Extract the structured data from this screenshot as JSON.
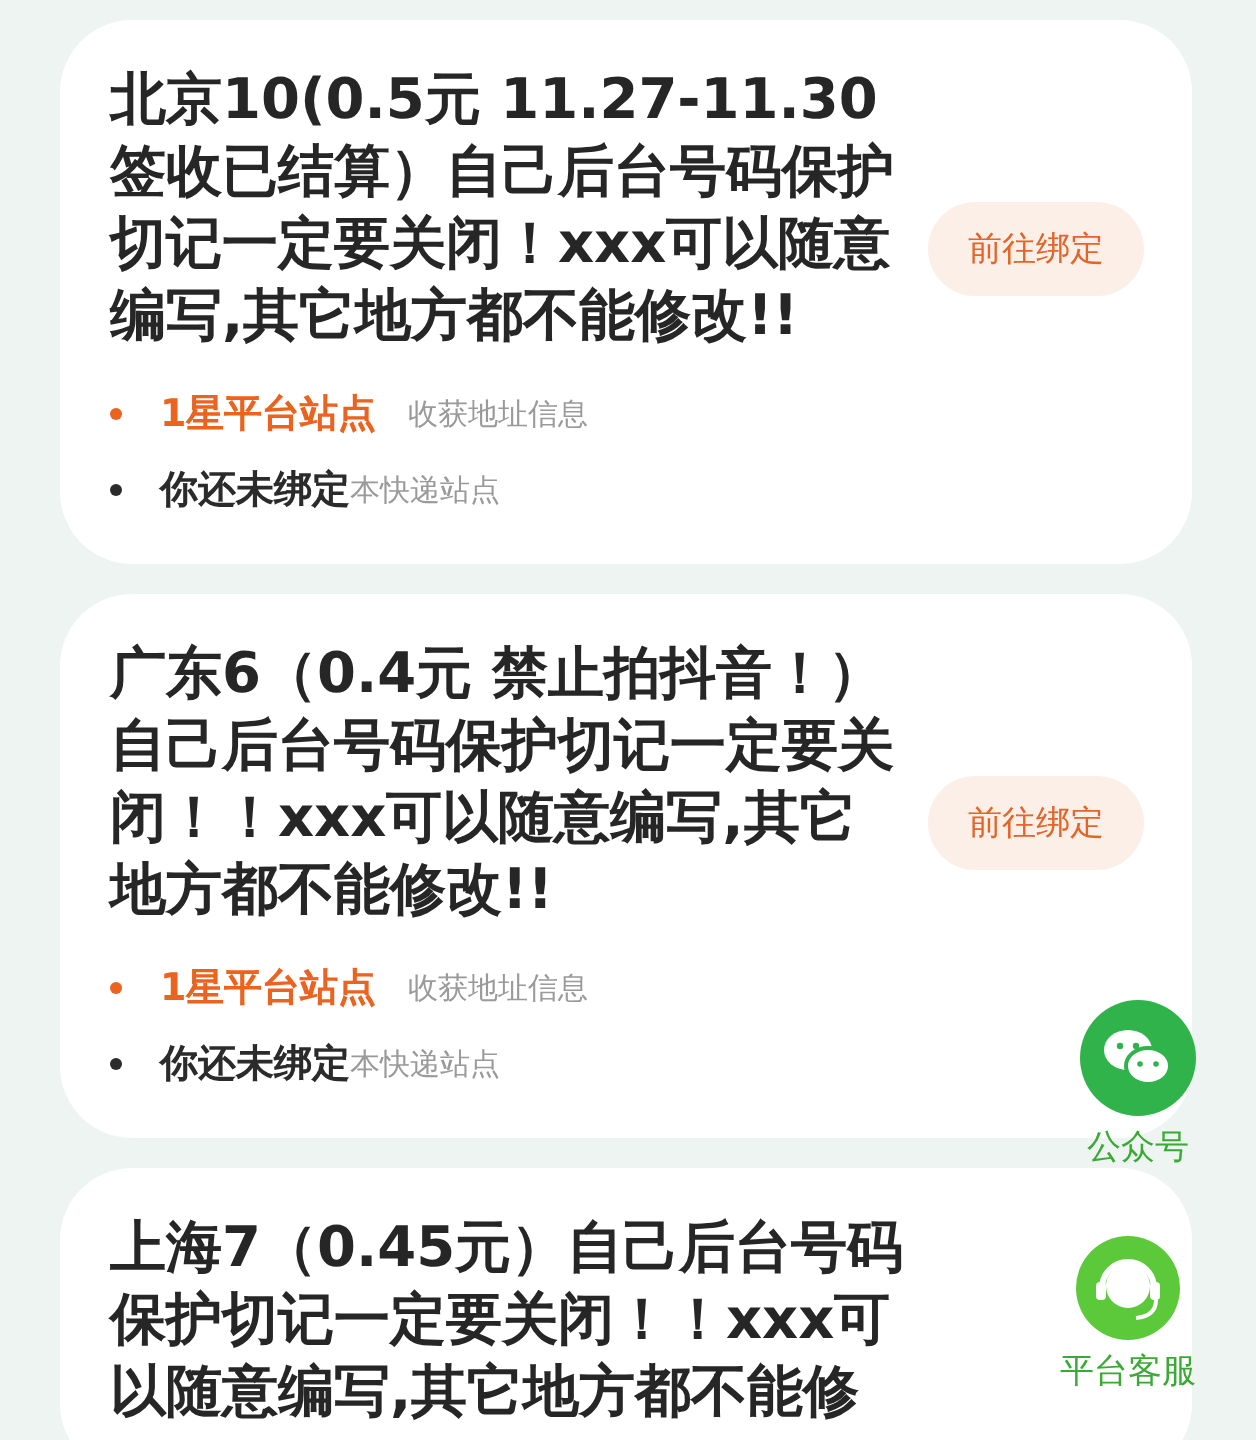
{
  "cards": [
    {
      "title": "北京10(0.5元 11.27-11.30签收已结算）自己后台号码保护切记一定要关闭！xxx可以随意编写,其它地方都不能修改!!",
      "button": "前往绑定",
      "items": [
        {
          "kind": "highlight",
          "label": "1星平台站点",
          "note": "收获地址信息"
        },
        {
          "kind": "plain",
          "label": "你还未绑定",
          "note": "本快递站点"
        }
      ]
    },
    {
      "title": "广东6（0.4元 禁止拍抖音！）自己后台号码保护切记一定要关闭！！xxx可以随意编写,其它地方都不能修改!!",
      "button": "前往绑定",
      "items": [
        {
          "kind": "highlight",
          "label": "1星平台站点",
          "note": "收获地址信息"
        },
        {
          "kind": "plain",
          "label": "你还未绑定",
          "note": "本快递站点"
        }
      ]
    },
    {
      "title": "上海7（0.45元）自己后台号码保护切记一定要关闭！！xxx可以随意编写,其它地方都不能修"
    }
  ],
  "floating": [
    {
      "kind": "wechat",
      "label": "公众号"
    },
    {
      "kind": "service",
      "label": "平台客服"
    }
  ]
}
